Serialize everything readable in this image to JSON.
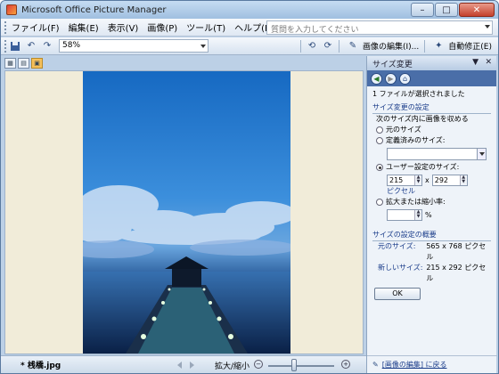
{
  "window": {
    "title": "Microsoft Office Picture Manager",
    "minimize": "–",
    "maximize": "□",
    "close": "✕"
  },
  "menubar": {
    "items": [
      "ファイル(F)",
      "編集(E)",
      "表示(V)",
      "画像(P)",
      "ツール(T)",
      "ヘルプ(H)"
    ],
    "help_placeholder": "質問を入力してください"
  },
  "toolbar": {
    "zoom_value": "58%",
    "edit_label": "画像の編集(I)...",
    "autofix_label": "自動修正(E)"
  },
  "canvas": {
    "background": "#f1ecd9"
  },
  "statusbar": {
    "filename": "* 桟橋.jpg",
    "zoom_label": "拡大/縮小",
    "zoom_out": "−",
    "zoom_in": "+",
    "slider_level": 0.4
  },
  "taskpane": {
    "title": "サイズ変更",
    "selected_info": "1 ファイルが選択されました",
    "settings_header": "サイズ変更の設定",
    "fit_label": "次のサイズ内に画像を収める",
    "options": [
      {
        "label": "元のサイズ",
        "selected": false
      },
      {
        "label": "定義済みのサイズ:",
        "selected": false
      },
      {
        "label": "ユーザー設定のサイズ:",
        "selected": true
      },
      {
        "label": "拡大または縮小率:",
        "selected": false
      }
    ],
    "width_value": "215",
    "height_value": "292",
    "x_symbol": "x",
    "pixel_label": "ピクセル",
    "percent_symbol": "%",
    "summary_header": "サイズの設定の概要",
    "original_size_label": "元のサイズ:",
    "original_size_value": "565 x 768 ピクセル",
    "new_size_label": "新しいサイズ:",
    "new_size_value": "215 x 292 ピクセル",
    "ok_label": "OK",
    "back_link": "[画像の編集] に戻る"
  },
  "colors": {
    "titlebar": "#b5cde8",
    "accent": "#4a6ea8",
    "link": "#1a3c8a"
  },
  "icons": [
    "save-icon",
    "undo-icon",
    "redo-icon",
    "rotate-left-icon",
    "rotate-right-icon",
    "edit-pictures-icon",
    "auto-correct-icon",
    "thumbnail-view-icon",
    "filmstrip-view-icon",
    "single-view-icon",
    "back-icon",
    "forward-icon",
    "home-icon",
    "previous-icon",
    "next-icon"
  ]
}
